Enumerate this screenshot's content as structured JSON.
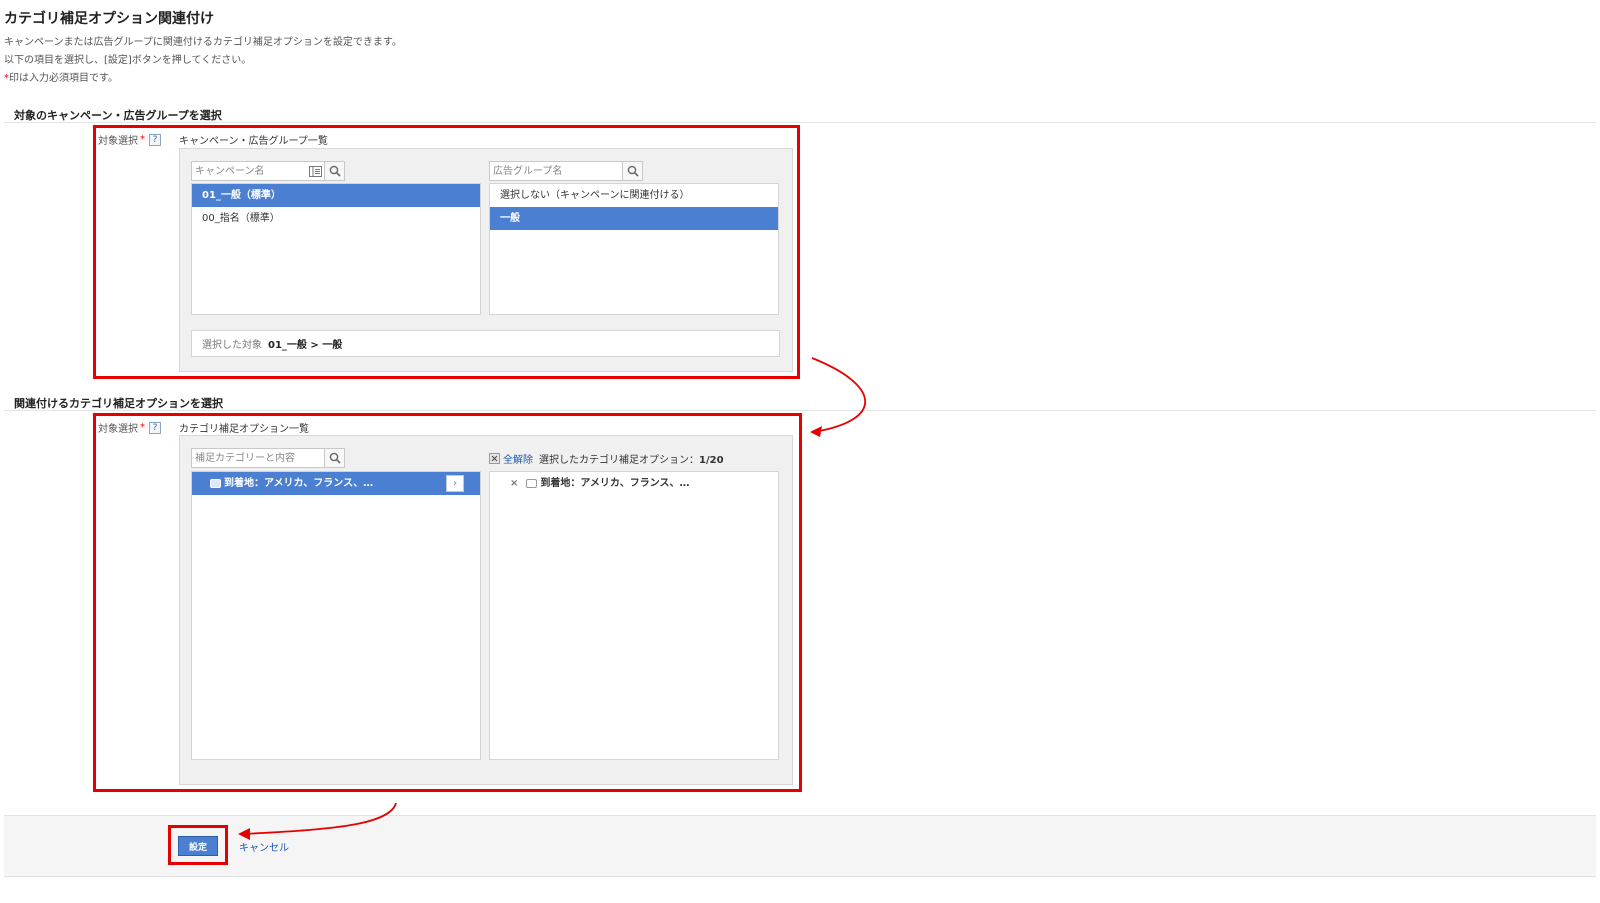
{
  "page": {
    "title": "カテゴリ補足オプション関連付け",
    "description_lines": [
      "キャンペーンまたは広告グループに関連付けるカテゴリ補足オプションを設定できます。",
      "以下の項目を選択し、[設定]ボタンを押してください。",
      "印は入力必須項目です。"
    ],
    "required_mark": "*"
  },
  "section1": {
    "title": "対象のキャンペーン・広告グループを選択",
    "field_label": "対象選択",
    "help": "?",
    "panel_title": "キャンペーン・広告グループ一覧",
    "campaign_search_placeholder": "キャンペーン名",
    "adgroup_search_placeholder": "広告グループ名",
    "campaigns": [
      {
        "label": "01_一般（標準）",
        "selected": true
      },
      {
        "label": "00_指名（標準）",
        "selected": false
      }
    ],
    "adgroups": [
      {
        "label": "選択しない（キャンペーンに関連付ける）",
        "selected": false
      },
      {
        "label": "一般",
        "selected": true
      }
    ],
    "selected_target_label": "選択した対象",
    "selected_target_value": "01_一般 > 一般"
  },
  "section2": {
    "title": "関連付けるカテゴリ補足オプションを選択",
    "field_label": "対象選択",
    "help": "?",
    "panel_title": "カテゴリ補足オプション一覧",
    "search_placeholder": "補足カテゴリーと内容",
    "available": [
      {
        "label": "到着地：アメリカ、フランス、…",
        "selected": true
      }
    ],
    "clear_all_label": "全解除",
    "selected_header_label": "選択したカテゴリ補足オプション：",
    "selected_count": "1/20",
    "selected": [
      {
        "label": "到着地：アメリカ、フランス、…"
      }
    ]
  },
  "footer": {
    "set_label": "設定",
    "cancel_label": "キャンセル"
  },
  "colors": {
    "accent": "#4b7fd1",
    "highlight_box": "#e60000",
    "required": "#e00000",
    "link": "#1a57b5"
  },
  "icons": {
    "search": "search-icon",
    "filter": "list-filter-icon",
    "help": "help-icon",
    "clear": "clear-x-icon",
    "move_right": "chevron-right-icon",
    "remove": "remove-x-icon",
    "option": "option-bubble-icon"
  }
}
